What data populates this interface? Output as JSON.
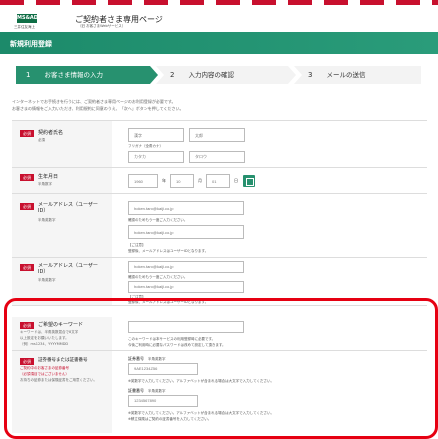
{
  "header": {
    "logo": "MS&AD",
    "logo_sub": "三井住友海上",
    "title": "ご契約者さま専用ページ",
    "subtitle": "（旧 お客さまWebサービス）"
  },
  "page_title": "新規利用登録",
  "steps": [
    {
      "num": "1",
      "label": "お客さま情報の入力",
      "active": true
    },
    {
      "num": "2",
      "label": "入力内容の確認",
      "active": false
    },
    {
      "num": "3",
      "label": "メールの送信",
      "active": false
    }
  ],
  "intro": [
    "インターネットでお手続きを行うには、ご契約者さま専用ページのお利用登録が必要です。",
    "お客さまの情報をご入力いただき、利用規約に同意のうえ、「次へ」ボタンを押してください。"
  ],
  "required_badge": "必須",
  "fields": {
    "name": {
      "label": "契約者氏名",
      "sub": "必須",
      "sei_placeholder": "漢字",
      "mei_placeholder": "太郎",
      "kana_label": "フリガナ（全角カナ）",
      "kana_sei_placeholder": "カタカ",
      "kana_mei_placeholder": "タロウ"
    },
    "birth": {
      "label": "生年月日",
      "sub": "半角数字",
      "year_placeholder": "1960",
      "year_unit": "年",
      "month_placeholder": "10",
      "month_unit": "月",
      "day_placeholder": "01",
      "day_unit": "日"
    },
    "email1": {
      "label": "メールアドレス（ユーザーID）",
      "sub": "半角英数字",
      "placeholder": "hoken.taro@kaiji.co.jp",
      "confirm_label": "確認のためもう一度ご入力ください。",
      "confirm_placeholder": "hoken.taro@kaiji.co.jp",
      "note_title": "【ご注意】",
      "note": "登録後、メールアドレスはユーザーIDとなります。"
    },
    "email2": {
      "label": "メールアドレス（ユーザーID）",
      "sub": "半角英数字",
      "placeholder": "hoken.taro@kaiji.co.jp",
      "confirm_label": "確認のためもう一度ご入力ください。",
      "confirm_placeholder": "hoken.taro@kaiji.co.jp",
      "note_title": "【ご注意】",
      "note": "登録後、メールアドレスはユーザーIDとなります。"
    },
    "password": {
      "label": "ご希望のキーワード",
      "sub1": "キーワードは、半角英数混合で8文字",
      "sub2": "以上設定をお願いいたします。",
      "sub3": "（例）ms1234、YYYYMMDD",
      "note1": "このキーワードは本サービスの利用登録時に必要です。",
      "note2": "今後ご利用時に必要なパスワードは改めて設定して頂きます。"
    },
    "policy": {
      "label": "証券番号または証書番号",
      "sub1": "ご契約中のお客さまの証券番号",
      "sub2": "（必須項目ではございません）",
      "sub3": "お持ちの証券または保険証書をご用意ください。",
      "securities_label": "証券番号",
      "securities_sub": "半角英数字",
      "securities_placeholder": "9AE1234Z56",
      "securities_note": "※英数字で入力してください。アルファベットが含まれる場合は大文字で入力してください。",
      "certificate_label": "証書番号",
      "certificate_sub": "半角英数字",
      "certificate_placeholder": "1234567890",
      "certificate_note": "※英数字で入力してください。アルファベットが含まれる場合は大文字で入力してください。",
      "certificate_warn": "※積立保険はご契約の証書番号を入力してください。"
    }
  },
  "colors": {
    "brand_green": "#27916f",
    "required_red": "#c8102e",
    "highlight_red": "#e60012"
  }
}
